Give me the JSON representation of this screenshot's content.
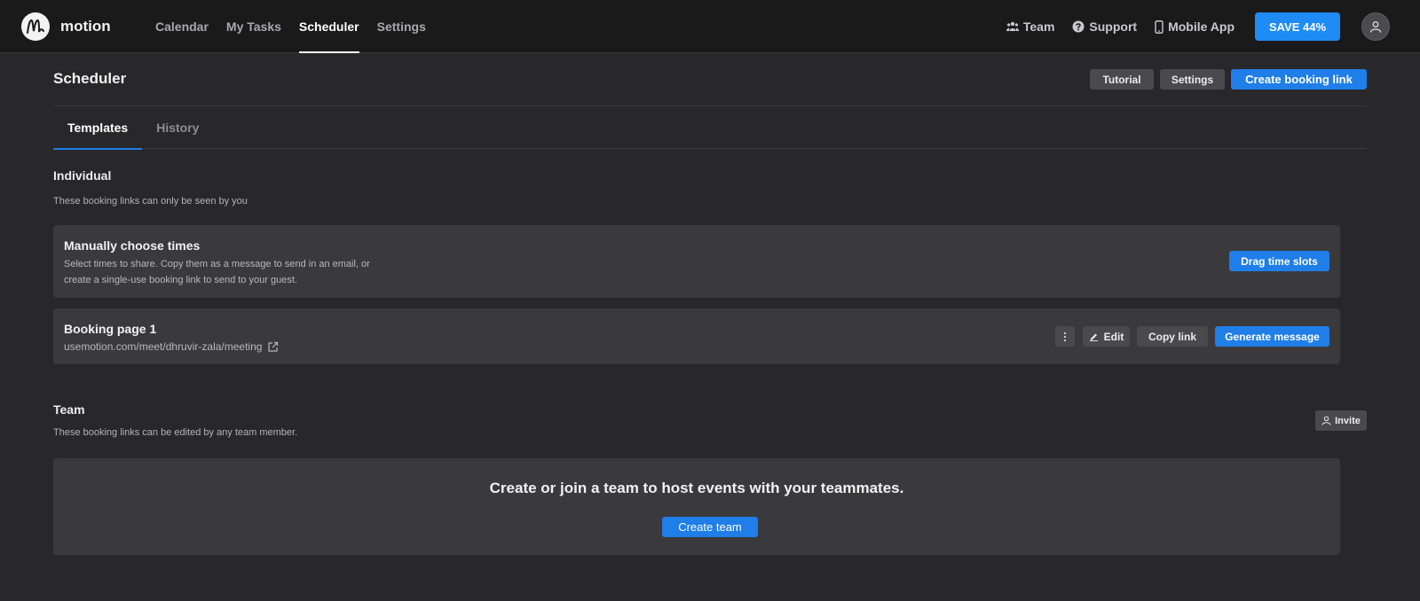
{
  "app": {
    "name": "motion",
    "logo_letter": "M"
  },
  "nav": {
    "links": [
      "Calendar",
      "My Tasks",
      "Scheduler",
      "Settings"
    ],
    "active": "Scheduler",
    "team": "Team",
    "support": "Support",
    "mobile_app": "Mobile App",
    "save_label": "SAVE 44%"
  },
  "page": {
    "title": "Scheduler",
    "tutorial_btn": "Tutorial",
    "settings_btn": "Settings",
    "create_link_btn": "Create booking link",
    "tabs": [
      "Templates",
      "History"
    ]
  },
  "individual": {
    "title": "Individual",
    "subtitle": "These booking links can only be seen by you",
    "manual_card": {
      "title": "Manually choose times",
      "desc_line1": "Select times to share. Copy them as a message to send in an email, or",
      "desc_line2": "create a single-use booking link to send to your guest.",
      "button": "Drag time slots"
    },
    "booking_card": {
      "title": "Booking page 1",
      "url": "usemotion.com/meet/dhruvir-zala/meeting",
      "edit": "Edit",
      "copy": "Copy link",
      "generate": "Generate message"
    }
  },
  "team": {
    "title": "Team",
    "subtitle": "These booking links can be edited by any team member.",
    "invite": "Invite",
    "cta_text": "Create or join a team to host events with your teammates.",
    "create_team": "Create team"
  },
  "colors": {
    "accent": "#1f7ee8",
    "save_accent": "#1f8bf5",
    "background": "#28282a",
    "topbar": "#1a1a1b",
    "card": "#3a3a3d"
  }
}
